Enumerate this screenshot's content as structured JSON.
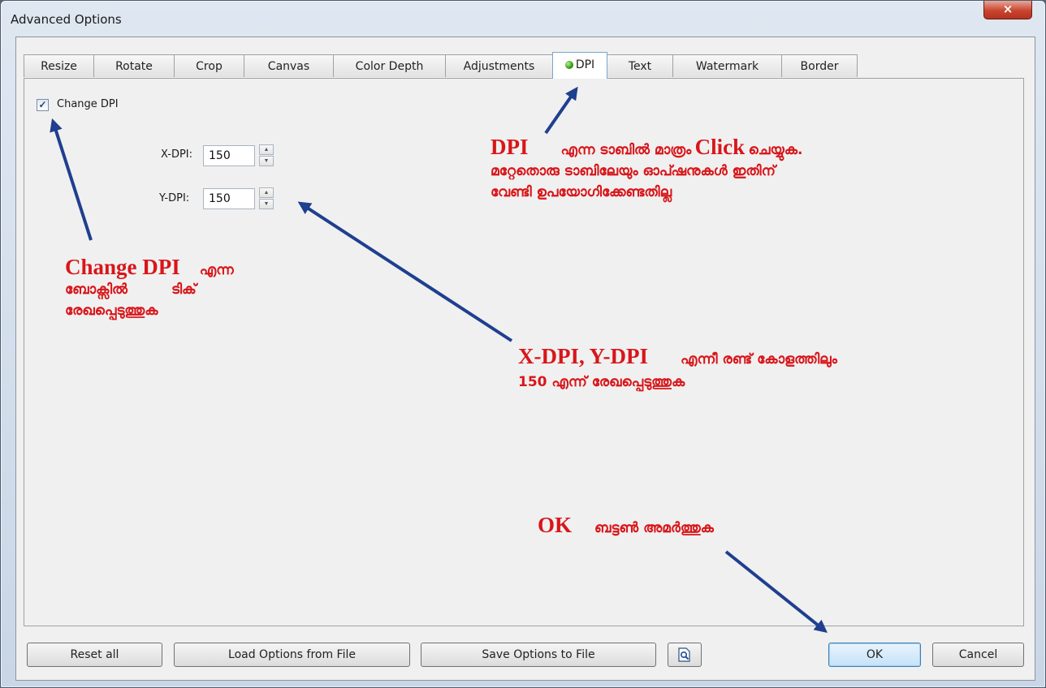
{
  "window": {
    "title": "Advanced Options",
    "close_glyph": "×"
  },
  "tabs": [
    {
      "label": "Resize"
    },
    {
      "label": "Rotate"
    },
    {
      "label": "Crop"
    },
    {
      "label": "Canvas"
    },
    {
      "label": "Color Depth"
    },
    {
      "label": "Adjustments"
    },
    {
      "label": "DPI",
      "active": true,
      "icon": "green-dot-icon"
    },
    {
      "label": "Text"
    },
    {
      "label": "Watermark"
    },
    {
      "label": "Border"
    }
  ],
  "dpi_panel": {
    "change_dpi": {
      "label": "Change DPI",
      "checked": true,
      "check_glyph": "✓"
    },
    "x_dpi": {
      "label": "X-DPI:",
      "value": "150"
    },
    "y_dpi": {
      "label": "Y-DPI:",
      "value": "150"
    },
    "spin_up_glyph": "▲",
    "spin_down_glyph": "▼"
  },
  "footer": {
    "reset_all": "Reset all",
    "load_options": "Load Options from File",
    "save_options": "Save Options to File",
    "preview_icon": "preview-magnifier-icon",
    "ok": "OK",
    "cancel": "Cancel"
  },
  "annotations": {
    "dpi_tab": {
      "big": "DPI",
      "line1_a": "എന്ന ടാബിൽ മാത്രം",
      "line1_big": "Click",
      "line1_b": "ചെയ്യുക.",
      "line2": "മറ്റേതൊരു ടാബിലേയും ഓപ്ഷനുകൾ ഇതിന്",
      "line3": "വേണ്ടി ഉപയോഗിക്കേണ്ടതില്ല"
    },
    "change_dpi": {
      "big": "Change DPI",
      "line1": "എന്ന",
      "line2_a": "ബോക്സിൽ",
      "line2_b": "ടിക്",
      "line3": "രേഖപ്പെടുത്തുക"
    },
    "xy_dpi": {
      "big": "X-DPI, Y-DPI",
      "line1": "എന്നീ രണ്ട് കോളത്തിലും",
      "line2": "150 എന്ന് രേഖപ്പെടുത്തുക"
    },
    "ok_button": {
      "big": "OK",
      "line1": "ബട്ടൺ അമർത്തുക"
    }
  },
  "colors": {
    "annotation_text": "#d8161a",
    "annotation_arrow": "#1f3f8f",
    "ok_button_accent": "#3c7fb1"
  }
}
